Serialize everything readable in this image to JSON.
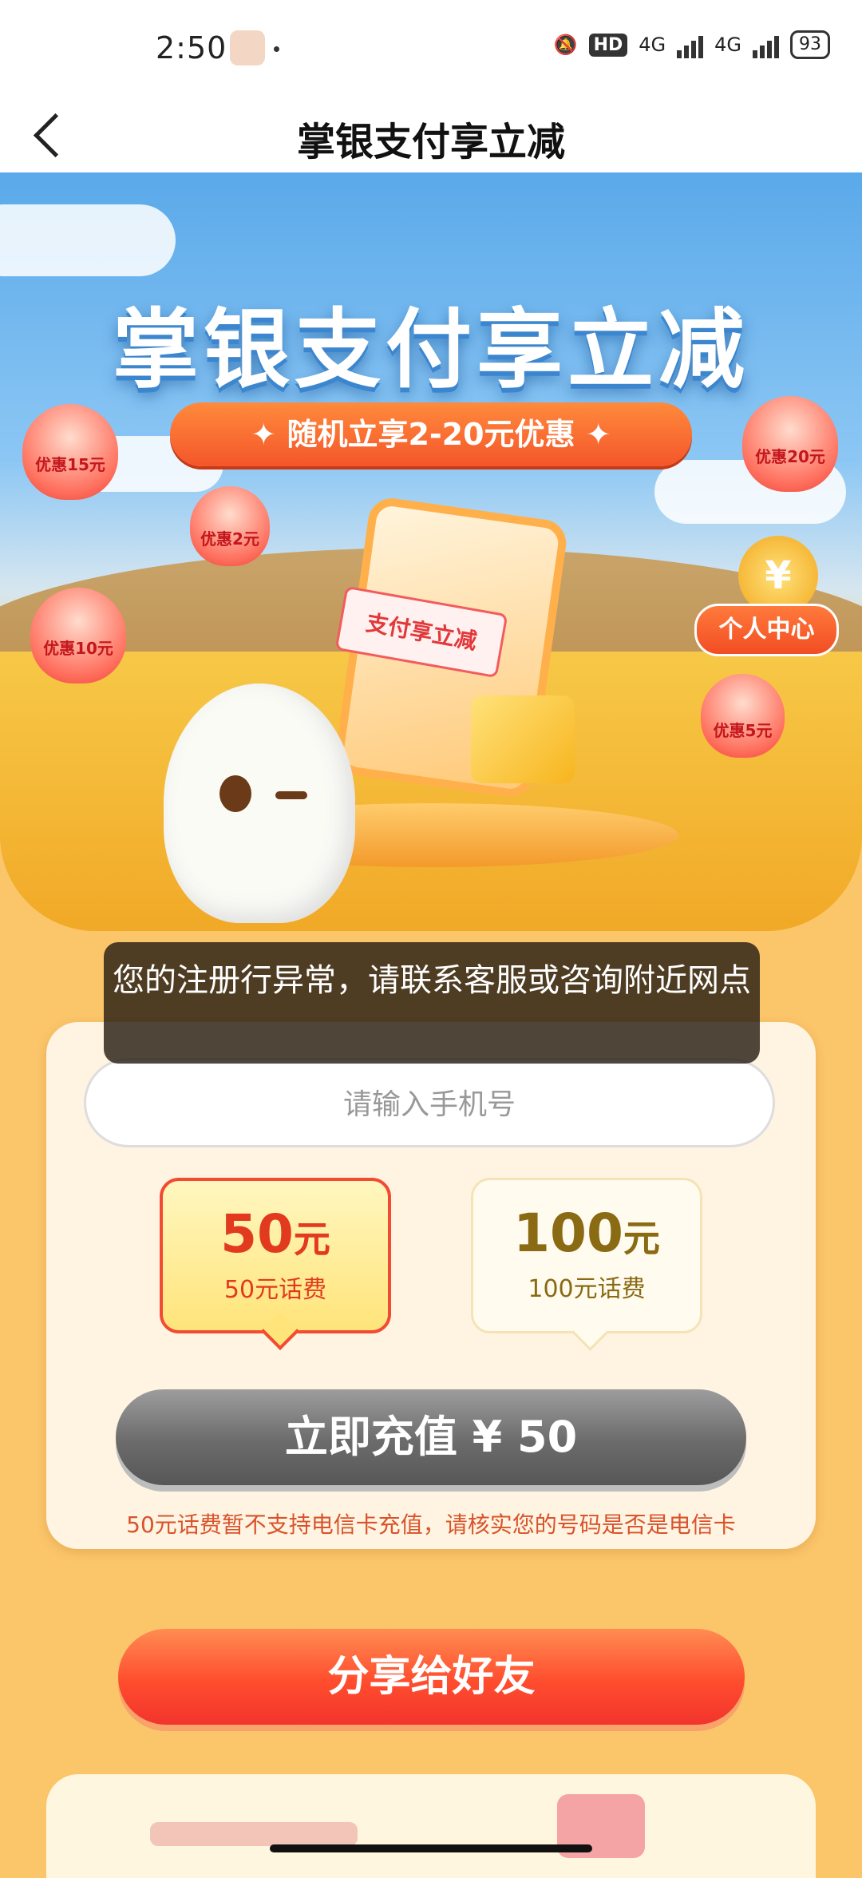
{
  "status_bar": {
    "time": "2:50",
    "network": "HD",
    "sim1": "4G",
    "sim2": "4G",
    "battery": "93"
  },
  "nav": {
    "title": "掌银支付享立减"
  },
  "hero": {
    "title": "掌银支付享立减",
    "subtitle": "随机立享2-20元优惠",
    "lanterns": [
      "优惠15元",
      "优惠2元",
      "优惠10元",
      "优惠20元",
      "优惠5元"
    ],
    "ticket": "支付享立减",
    "personal_center": "个人中心",
    "coin_symbol": "¥"
  },
  "toast": {
    "message": "您的注册行异常，请联系客服或咨询附近网点"
  },
  "form": {
    "phone_placeholder": "请输入手机号",
    "options": [
      {
        "amount": "50",
        "unit": "元",
        "desc": "50元话费",
        "selected": true
      },
      {
        "amount": "100",
        "unit": "元",
        "desc": "100元话费",
        "selected": false
      }
    ],
    "recharge_label": "立即充值 ¥ 50",
    "notice": "50元话费暂不支持电信卡充值，请核实您的号码是否是电信卡"
  },
  "share": {
    "label": "分享给好友"
  },
  "colors": {
    "accent": "#f24a33",
    "disabled": "#6b6b6b",
    "toast": "#3a2d1f"
  }
}
